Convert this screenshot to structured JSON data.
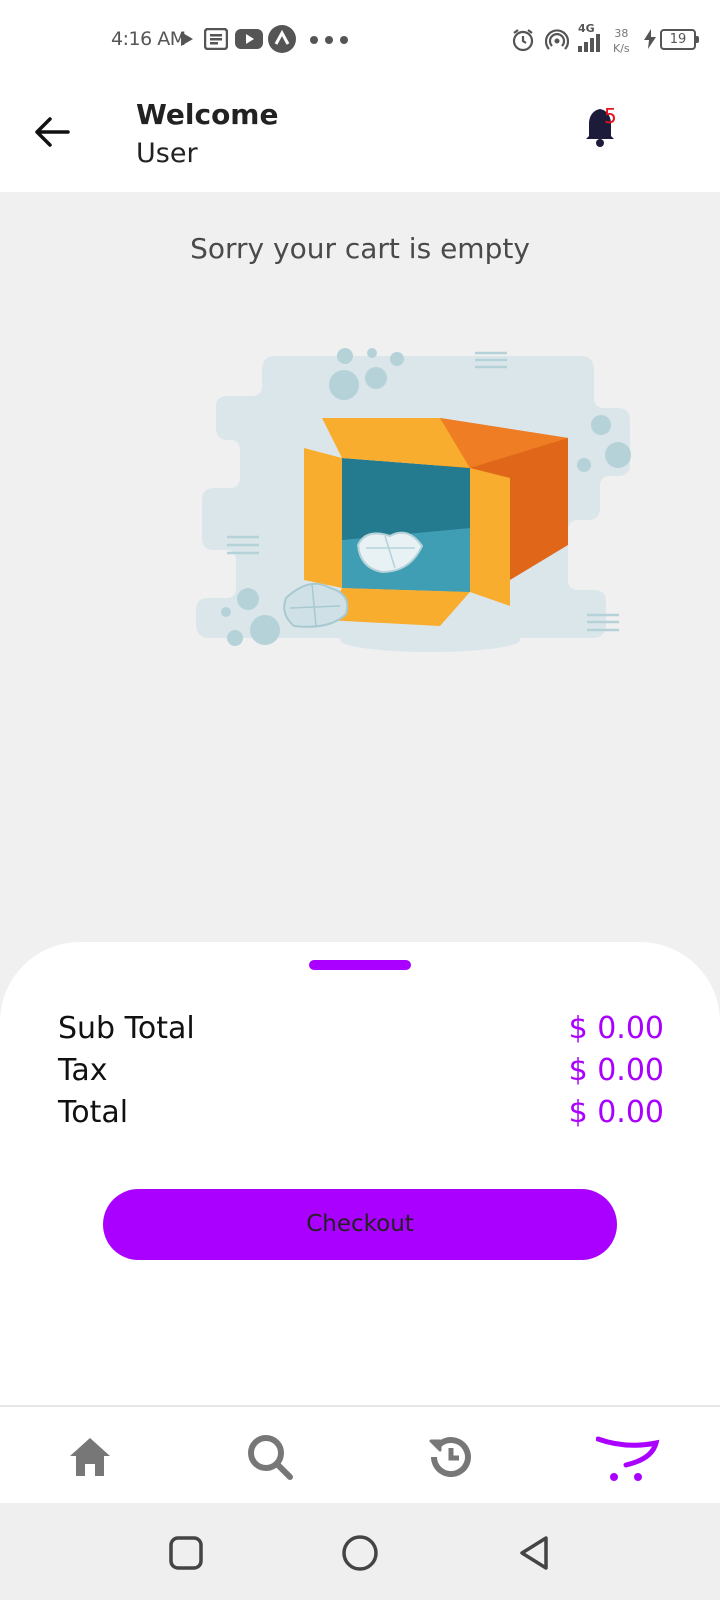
{
  "status_bar": {
    "time": "4:16 AM",
    "network_label": "4G",
    "speed_value": "38",
    "speed_unit": "K/s",
    "battery": "19",
    "icons": [
      "play-icon",
      "news-icon",
      "youtube-icon",
      "app-icon",
      "more-dots-icon",
      "alarm-icon",
      "hotspot-icon",
      "signal-icon",
      "charging-icon",
      "battery-icon"
    ]
  },
  "header": {
    "title": "Welcome",
    "subtitle": "User",
    "notification_count": "5"
  },
  "cart": {
    "empty_message": "Sorry your cart is empty",
    "illustration": "empty-box-illustration"
  },
  "summary": {
    "rows": [
      {
        "label": "Sub Total",
        "value": "$ 0.00"
      },
      {
        "label": "Tax",
        "value": "$ 0.00"
      },
      {
        "label": "Total",
        "value": "$ 0.00"
      }
    ],
    "checkout_label": "Checkout"
  },
  "bottom_nav": {
    "items": [
      "home-icon",
      "search-icon",
      "history-icon",
      "cart-icon"
    ],
    "active": "cart-icon"
  },
  "colors": {
    "accent": "#aa00ff",
    "badge": "#e8101a",
    "icon_inactive": "#777777",
    "background": "#f0f0f0"
  }
}
